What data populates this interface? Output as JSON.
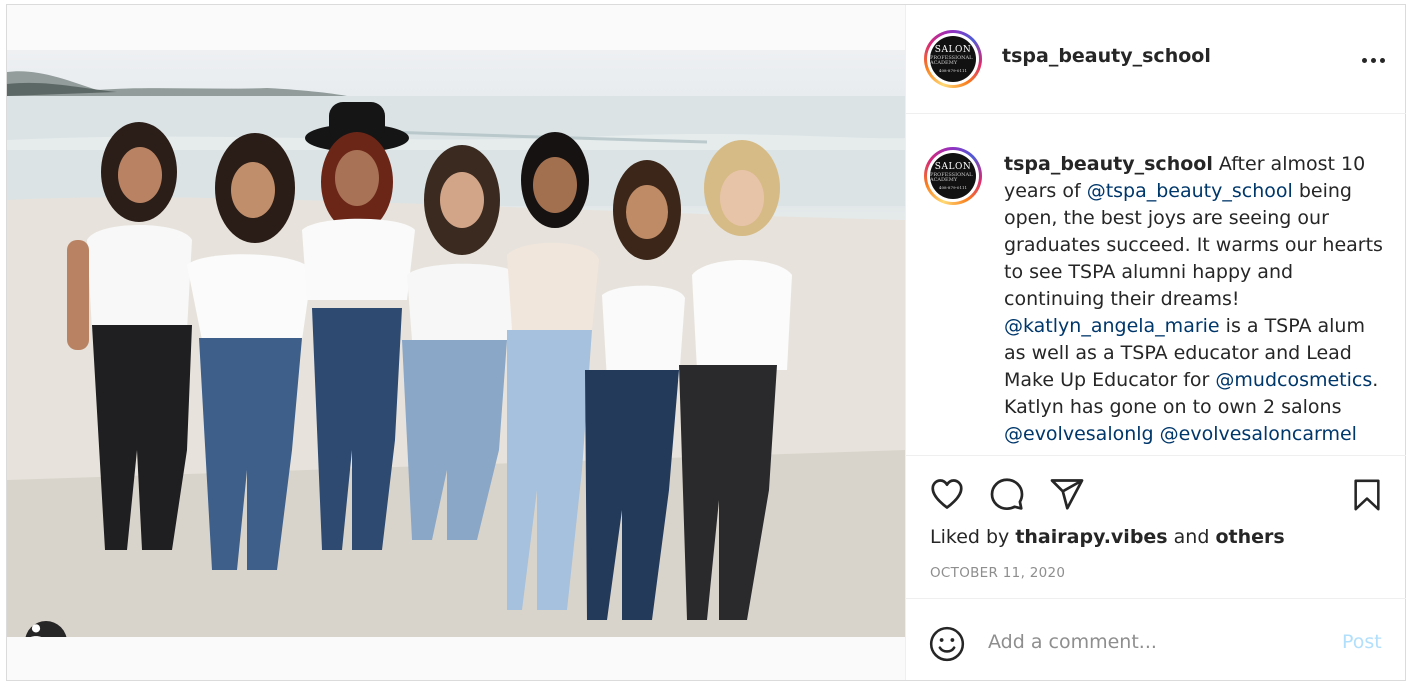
{
  "post": {
    "username": "tspa_beauty_school",
    "avatar_logo": {
      "line1": "SALON",
      "line2": "PROFESSIONAL ACADEMY",
      "line3": "408-879-0111"
    },
    "more_icon": "more-horizontal-icon",
    "caption": {
      "author": "tspa_beauty_school",
      "text1": " After almost 10 years of ",
      "mention1": "@tspa_beauty_school",
      "text2": " being open, the best joys are seeing our graduates succeed. It warms our hearts to see TSPA alumni happy and continuing their dreams! ",
      "mention2": "@katlyn_angela_marie",
      "text3": " is a TSPA alum as well as a TSPA educator and Lead Make Up Educator for ",
      "mention3": "@mudcosmetics",
      "text4": ". Katlyn has gone on to own 2 salons ",
      "mention4": "@evolvesalonlg",
      "text5": " ",
      "mention5": "@evolvesaloncarmel"
    },
    "actions": {
      "like_icon": "heart-icon",
      "comment_icon": "comment-bubble-icon",
      "share_icon": "paper-plane-icon",
      "save_icon": "bookmark-icon"
    },
    "likes": {
      "prefix": "Liked by ",
      "user": "thairapy.vibes",
      "middle": " and ",
      "others": "others"
    },
    "date": "OCTOBER 11, 2020",
    "comment_box": {
      "emoji_icon": "smiley-icon",
      "placeholder": "Add a comment...",
      "post_label": "Post"
    },
    "photo": {
      "tag_icon": "user-tag-icon"
    },
    "colors": {
      "mention": "#00376b",
      "post_disabled": "#b2dffc",
      "date": "#8e8e8e"
    }
  }
}
